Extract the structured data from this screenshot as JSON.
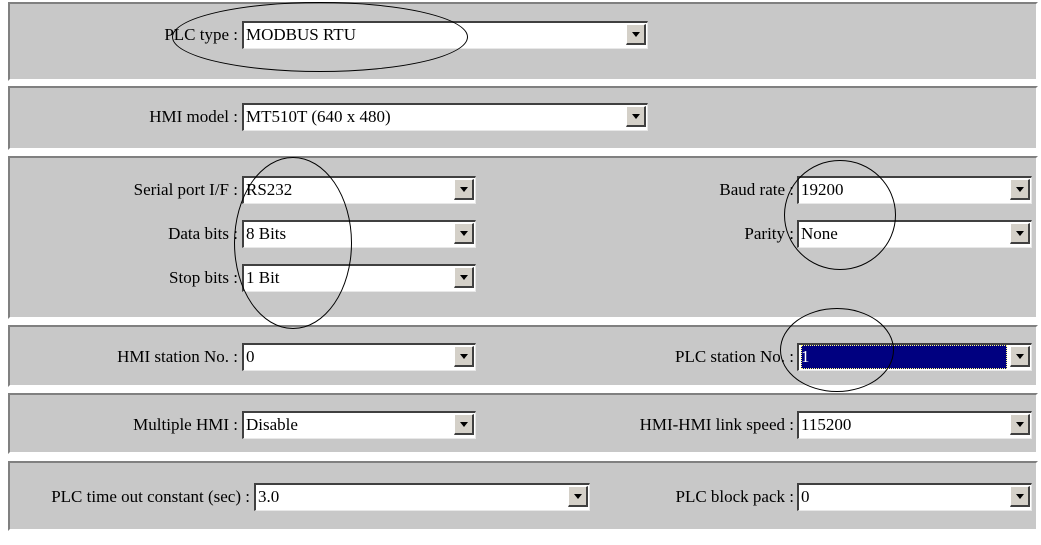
{
  "plc_type": {
    "label": "PLC type :",
    "value": "MODBUS RTU"
  },
  "hmi_model": {
    "label": "HMI model :",
    "value": "MT510T (640 x 480)"
  },
  "serial": {
    "port_if": {
      "label": "Serial port I/F :",
      "value": "RS232"
    },
    "data_bits": {
      "label": "Data bits :",
      "value": "8 Bits"
    },
    "stop_bits": {
      "label": "Stop bits :",
      "value": "1 Bit"
    },
    "baud_rate": {
      "label": "Baud rate :",
      "value": "19200"
    },
    "parity": {
      "label": "Parity :",
      "value": "None"
    }
  },
  "station": {
    "hmi": {
      "label": "HMI station No. :",
      "value": "0"
    },
    "plc": {
      "label": "PLC station No. :",
      "value": "1"
    }
  },
  "multi": {
    "multiple_hmi": {
      "label": "Multiple HMI :",
      "value": "Disable"
    },
    "link_speed": {
      "label": "HMI-HMI link speed :",
      "value": "115200"
    }
  },
  "timing": {
    "timeout": {
      "label": "PLC time out constant (sec) :",
      "value": "3.0"
    },
    "block_pack": {
      "label": "PLC block pack :",
      "value": "0"
    }
  },
  "colors": {
    "panel_bg": "#c8c8c8",
    "selection": "#000080"
  }
}
